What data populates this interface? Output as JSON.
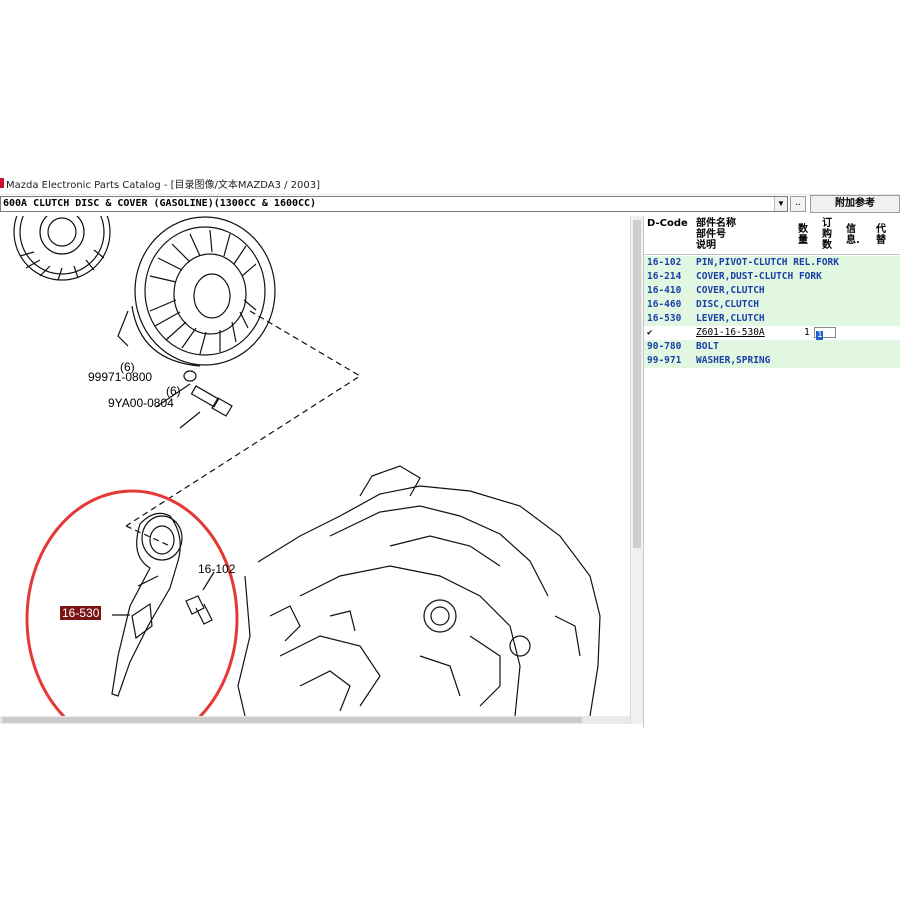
{
  "window": {
    "title": "Mazda Electronic Parts Catalog - [目录图像/文本MAZDA3 / 2003]"
  },
  "toolbar": {
    "selector_value": "600A  CLUTCH DISC & COVER (GASOLINE)(1300CC & 1600CC)",
    "dropdown_glyph": "▼",
    "browse_label": "..",
    "reference_label": "附加参考"
  },
  "diagram": {
    "callouts": {
      "c1_qty": "(6)",
      "c1_part": "99971-0800",
      "c2_qty": "(6)",
      "c2_part": "9YA00-0804",
      "lever": "16-530",
      "pin": "16-102"
    },
    "highlight_color": "#7a1515",
    "circle_color": "#e53935"
  },
  "parts_table": {
    "headers": {
      "dcode": "D-Code",
      "name": "部件名称\n部件号\n说明",
      "qty": "数\n量",
      "order": "订\n购\n数",
      "info": "信\n息.",
      "sub": "代\n替"
    },
    "rows": [
      {
        "code": "16-102",
        "desc": "PIN,PIVOT-CLUTCH REL.FORK"
      },
      {
        "code": "16-214",
        "desc": "COVER,DUST-CLUTCH FORK"
      },
      {
        "code": "16-410",
        "desc": "COVER,CLUTCH"
      },
      {
        "code": "16-460",
        "desc": "DISC,CLUTCH"
      },
      {
        "code": "16-530",
        "desc": "LEVER,CLUTCH"
      }
    ],
    "selected_sub": {
      "check": "✔",
      "part_no": "Z601-16-530A",
      "qty": "1",
      "order": "1"
    },
    "rows_after": [
      {
        "code": "90-780",
        "desc": "BOLT"
      },
      {
        "code": "99-971",
        "desc": "WASHER,SPRING"
      }
    ],
    "row_bg": "#e1f7e1",
    "row_text": "#1a3fa8"
  }
}
